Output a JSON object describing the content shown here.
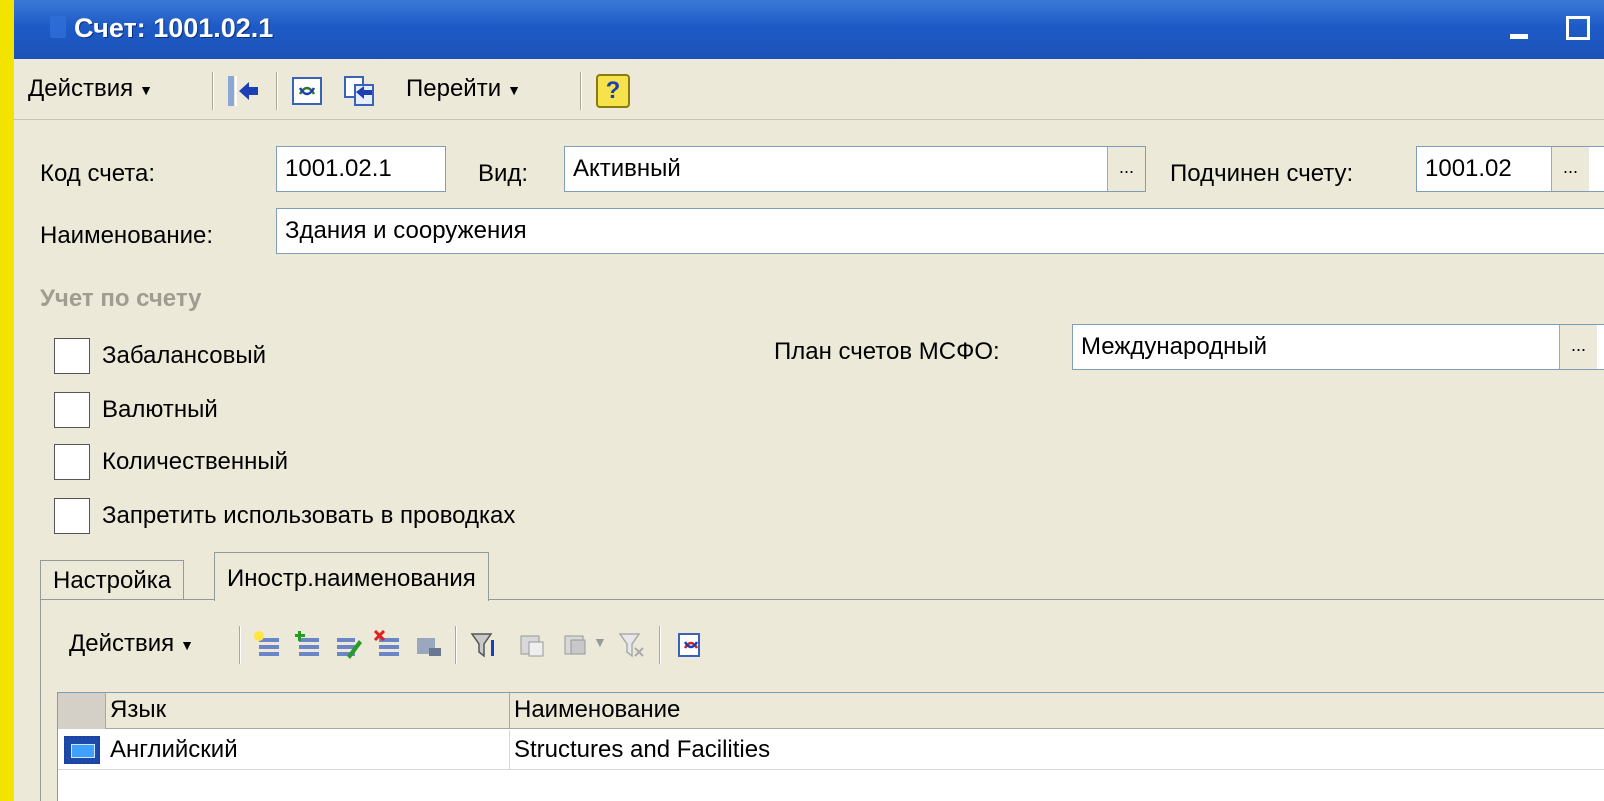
{
  "window": {
    "title": "Счет: 1001.02.1"
  },
  "toolbar": {
    "actions_label": "Действия",
    "goto_label": "Перейти",
    "help_label": "?",
    "icons": [
      "back-arrow-icon",
      "refresh-icon",
      "copy-icon",
      "help-icon"
    ]
  },
  "form": {
    "code_label": "Код счета:",
    "code_value": "1001.02.1",
    "kind_label": "Вид:",
    "kind_value": "Активный",
    "parent_label": "Подчинен счету:",
    "parent_value": "1001.02",
    "name_label": "Наименование:",
    "name_value": "Здания и сооружения",
    "pick_button": "...",
    "section_title": "Учет по счету",
    "ifrs_label": "План счетов МСФО:",
    "ifrs_value": "Международный",
    "checkboxes": [
      {
        "label": "Забалансовый",
        "checked": false
      },
      {
        "label": "Валютный",
        "checked": false
      },
      {
        "label": "Количественный",
        "checked": false
      },
      {
        "label": "Запретить использовать в проводках",
        "checked": false
      }
    ]
  },
  "tabs": [
    {
      "label": "Настройка",
      "active": false
    },
    {
      "label": "Иностр.наименования",
      "active": true
    }
  ],
  "subtable": {
    "actions_label": "Действия",
    "columns": [
      "Язык",
      "Наименование"
    ],
    "rows": [
      {
        "language": "Английский",
        "name": "Structures and Facilities"
      }
    ]
  },
  "colors": {
    "titlebar": "#1e5ac6",
    "background": "#ece9d8",
    "desktop": "#f2e400"
  }
}
